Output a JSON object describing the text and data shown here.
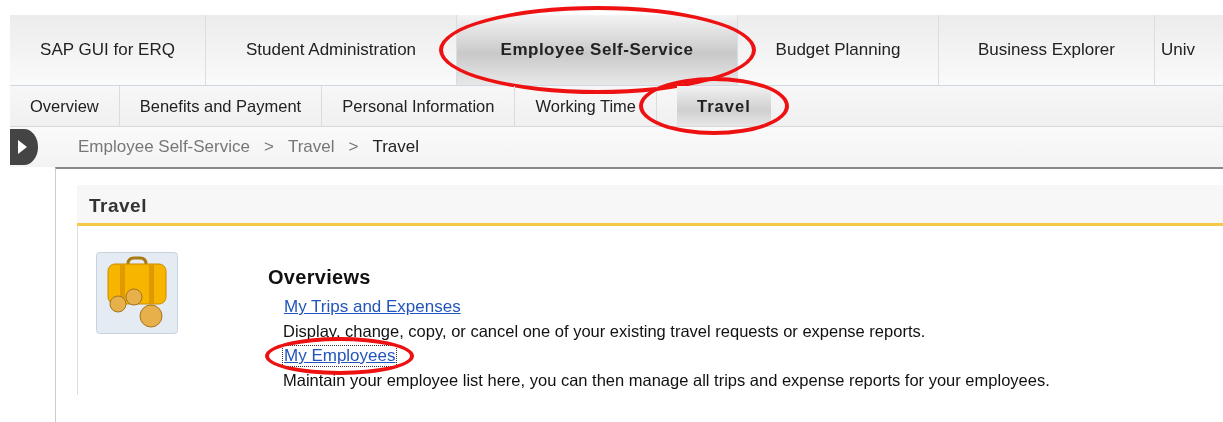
{
  "top_tabs": [
    {
      "label": "SAP GUI for ERQ",
      "selected": false,
      "circled": false
    },
    {
      "label": "Student Administration",
      "selected": false,
      "circled": false
    },
    {
      "label": "Employee Self-Service",
      "selected": true,
      "circled": true
    },
    {
      "label": "Budget Planning",
      "selected": false,
      "circled": false
    },
    {
      "label": "Business Explorer",
      "selected": false,
      "circled": false
    },
    {
      "label": "Univ",
      "selected": false,
      "circled": false
    }
  ],
  "sub_tabs": [
    {
      "label": "Overview",
      "selected": false,
      "circled": false
    },
    {
      "label": "Benefits and Payment",
      "selected": false,
      "circled": false
    },
    {
      "label": "Personal Information",
      "selected": false,
      "circled": false
    },
    {
      "label": "Working Time",
      "selected": false,
      "circled": false
    },
    {
      "label": "Travel",
      "selected": true,
      "circled": true
    }
  ],
  "breadcrumb": {
    "separator": ">",
    "items": [
      {
        "label": "Employee Self-Service",
        "current": false
      },
      {
        "label": "Travel",
        "current": false
      },
      {
        "label": "Travel",
        "current": true
      }
    ]
  },
  "panel": {
    "title": "Travel",
    "section_title": "Overviews",
    "links": [
      {
        "label": "My Trips and Expenses",
        "description": "Display, change, copy, or cancel one of your existing travel requests or expense reports.",
        "circled": false,
        "focused": false
      },
      {
        "label": "My Employees",
        "description": "Maintain your employee list here, you can then manage all trips and expense reports for your employees.",
        "circled": true,
        "focused": true
      }
    ]
  }
}
